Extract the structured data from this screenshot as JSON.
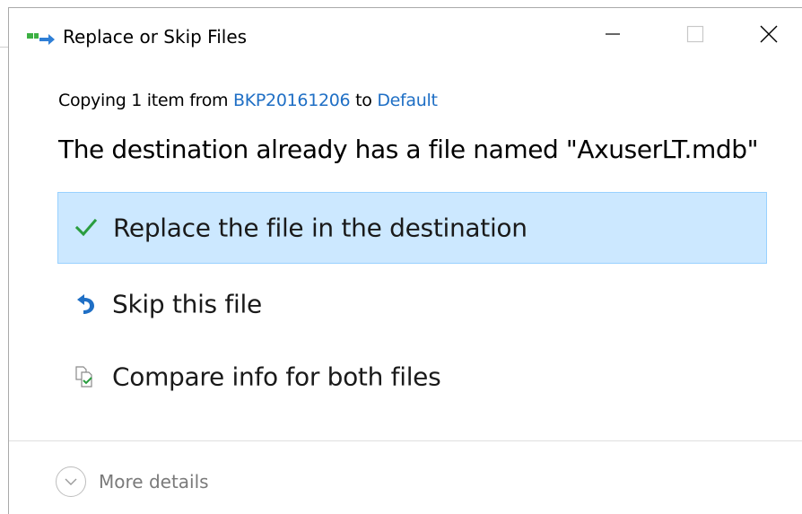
{
  "window": {
    "title": "Replace or Skip Files",
    "title_icon": "file-move-icon",
    "controls": {
      "minimize": "minimize-icon",
      "maximize": "maximize-icon",
      "close": "close-icon"
    }
  },
  "copy_status": {
    "prefix": "Copying 1 item from",
    "source": "BKP20161206",
    "joiner": "to",
    "destination": "Default"
  },
  "message": "The destination already has a file named \"AxuserLT.mdb\"",
  "options": [
    {
      "label": "Replace the file in the destination",
      "icon": "checkmark-icon",
      "selected": true
    },
    {
      "label": "Skip this file",
      "icon": "skip-arrow-icon",
      "selected": false
    },
    {
      "label": "Compare info for both files",
      "icon": "compare-files-icon",
      "selected": false
    }
  ],
  "footer": {
    "more_details_label": "More details",
    "icon": "chevron-down-icon"
  },
  "colors": {
    "link": "#1f6fc5",
    "selection_bg": "#cce8ff",
    "selection_border": "#99d1ff",
    "check_green": "#2a9d3f",
    "skip_blue": "#1f6fc5"
  }
}
